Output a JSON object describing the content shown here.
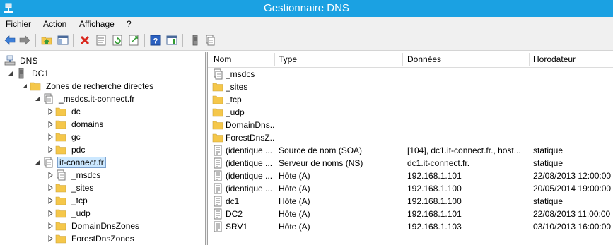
{
  "window": {
    "title": "Gestionnaire DNS"
  },
  "menu": [
    "Fichier",
    "Action",
    "Affichage",
    "?"
  ],
  "toolbar": {
    "icons": [
      "arrow-left-icon",
      "arrow-right-icon",
      "folder-up-icon",
      "show-console-tree-icon",
      "delete-icon",
      "properties-icon",
      "refresh-icon",
      "export-list-icon",
      "help-icon",
      "show-hide-action-pane-icon",
      "server-icon",
      "record-icon"
    ]
  },
  "tree": {
    "root": "DNS",
    "server": "DC1",
    "forward_zones": "Zones de recherche directes",
    "msdcs_zone": "_msdcs.it-connect.fr",
    "msdcs_children": [
      "dc",
      "domains",
      "gc",
      "pdc"
    ],
    "itc_zone": "it-connect.fr",
    "itc_children": [
      "_msdcs",
      "_sites",
      "_tcp",
      "_udp",
      "DomainDnsZones",
      "ForestDnsZones"
    ]
  },
  "list": {
    "columns": [
      "Nom",
      "Type",
      "Données",
      "Horodateur"
    ],
    "rows": [
      {
        "icon": "zone",
        "name": "_msdcs",
        "type": "",
        "data": "",
        "ts": ""
      },
      {
        "icon": "folder",
        "name": "_sites",
        "type": "",
        "data": "",
        "ts": ""
      },
      {
        "icon": "folder",
        "name": "_tcp",
        "type": "",
        "data": "",
        "ts": ""
      },
      {
        "icon": "folder",
        "name": "_udp",
        "type": "",
        "data": "",
        "ts": ""
      },
      {
        "icon": "folder",
        "name": "DomainDns...",
        "type": "",
        "data": "",
        "ts": ""
      },
      {
        "icon": "folder",
        "name": "ForestDnsZ...",
        "type": "",
        "data": "",
        "ts": ""
      },
      {
        "icon": "record",
        "name": "(identique ...",
        "type": "Source de nom (SOA)",
        "data": "[104], dc1.it-connect.fr., host...",
        "ts": "statique"
      },
      {
        "icon": "record",
        "name": "(identique ...",
        "type": "Serveur de noms (NS)",
        "data": "dc1.it-connect.fr.",
        "ts": "statique"
      },
      {
        "icon": "record",
        "name": "(identique ...",
        "type": "Hôte (A)",
        "data": "192.168.1.101",
        "ts": "22/08/2013 12:00:00"
      },
      {
        "icon": "record",
        "name": "(identique ...",
        "type": "Hôte (A)",
        "data": "192.168.1.100",
        "ts": "20/05/2014 19:00:00"
      },
      {
        "icon": "record",
        "name": "dc1",
        "type": "Hôte (A)",
        "data": "192.168.1.100",
        "ts": "statique"
      },
      {
        "icon": "record",
        "name": "DC2",
        "type": "Hôte (A)",
        "data": "192.168.1.101",
        "ts": "22/08/2013 11:00:00"
      },
      {
        "icon": "record",
        "name": "SRV1",
        "type": "Hôte (A)",
        "data": "192.168.1.103",
        "ts": "03/10/2013 16:00:00"
      }
    ]
  },
  "colors": {
    "titlebar": "#1ba1e2",
    "selection": "#cce8ff",
    "folder": "#f5c74a"
  }
}
